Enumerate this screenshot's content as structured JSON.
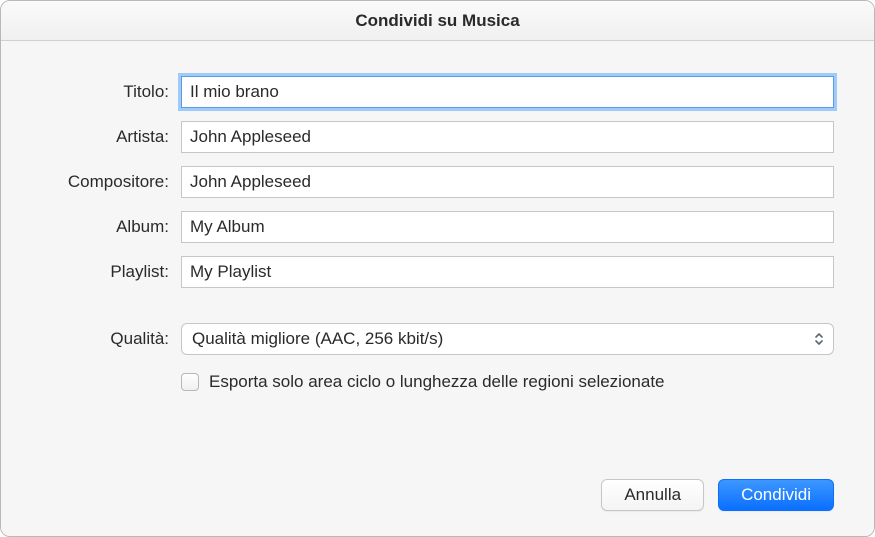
{
  "window": {
    "title": "Condividi su Musica"
  },
  "form": {
    "title_label": "Titolo:",
    "title_value": "Il mio brano",
    "artist_label": "Artista:",
    "artist_value": "John Appleseed",
    "composer_label": "Compositore:",
    "composer_value": "John Appleseed",
    "album_label": "Album:",
    "album_value": "My Album",
    "playlist_label": "Playlist:",
    "playlist_value": "My Playlist",
    "quality_label": "Qualità:",
    "quality_value": "Qualità migliore (AAC, 256 kbit/s)",
    "export_checkbox_label": "Esporta solo area ciclo o lunghezza delle regioni selezionate",
    "export_checkbox_checked": false
  },
  "buttons": {
    "cancel": "Annulla",
    "share": "Condividi"
  }
}
